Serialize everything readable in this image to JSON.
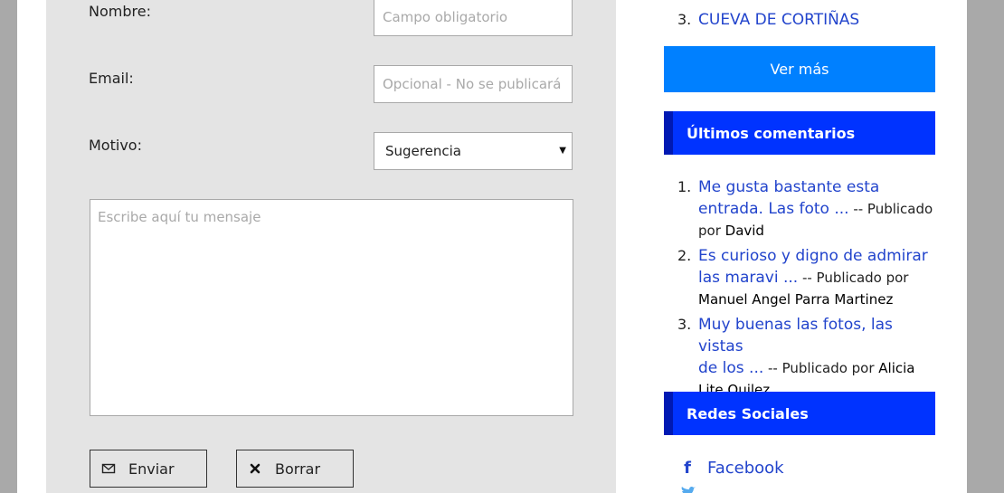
{
  "form": {
    "name_label": "Nombre:",
    "name_placeholder": "Campo obligatorio",
    "email_label": "Email:",
    "email_placeholder": "Opcional - No se publicará",
    "motivo_label": "Motivo:",
    "motivo_value": "Sugerencia",
    "message_placeholder": "Escribe aquí tu mensaje",
    "send_label": "Enviar",
    "clear_label": "Borrar"
  },
  "top_list": {
    "items": [
      {
        "num": "3.",
        "label": "CUEVA DE CORTIÑAS"
      }
    ]
  },
  "ver_mas_label": "Ver más",
  "comments": {
    "title": "Últimos comentarios",
    "items": [
      {
        "num": "1.",
        "snippet_a": "Me gusta bastante esta",
        "snippet_b": "entrada. Las foto ...",
        "meta_a": " -- Publicado",
        "meta_b": "por ",
        "author": "David"
      },
      {
        "num": "2.",
        "snippet_a": "Es curioso y digno de admirar",
        "snippet_b": "las maravi ...",
        "meta_a": " -- Publicado por",
        "meta_b": "",
        "author": "Manuel Angel Parra Martinez"
      },
      {
        "num": "3.",
        "snippet_a": "Muy buenas las fotos, las vistas",
        "snippet_b": "de los ...",
        "meta_a": " -- Publicado por ",
        "meta_b": "",
        "author_a": "Alicia",
        "author_b": "Lite Quilez"
      }
    ]
  },
  "social": {
    "title": "Redes Sociales",
    "items": [
      {
        "icon": "facebook-icon",
        "label": "Facebook"
      }
    ]
  },
  "colors": {
    "link": "#2244cc",
    "button_blue": "#0080ff",
    "widget_header": "#0033ff",
    "panel_bg": "#e4e4e4"
  }
}
